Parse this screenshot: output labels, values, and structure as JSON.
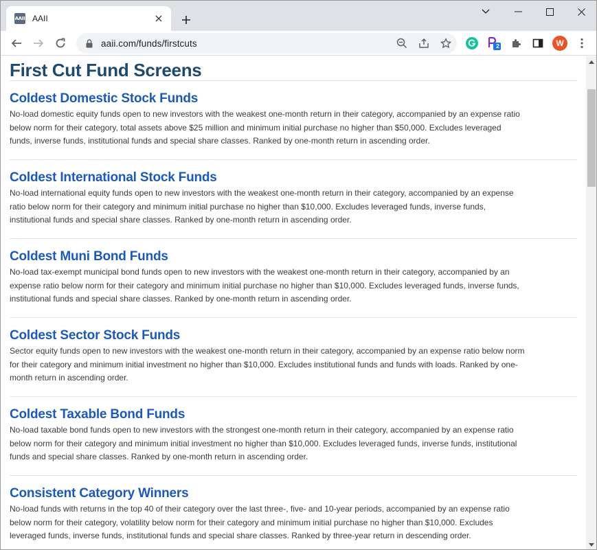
{
  "browser": {
    "tab": {
      "favicon_text": "AAII",
      "title": "AAII"
    },
    "address": {
      "url": "aaii.com/funds/firstcuts"
    },
    "profile_initial": "W",
    "extension_badge": "2",
    "colors": {
      "accent_profile": "#e8542a",
      "grammarly": "#15c39a",
      "ext_p": "#7b2fbf"
    }
  },
  "page": {
    "title": "First Cut Fund Screens",
    "colors": {
      "title": "#1f4a6e",
      "link": "#1d59b8"
    },
    "funds": [
      {
        "title": "Coldest Domestic Stock Funds",
        "description": "No-load domestic equity funds open to new investors with the weakest one-month return in their category, accompanied by an expense ratio below norm for their category, total assets above $25 million and minimum initial purchase no higher than $50,000. Excludes leveraged funds, inverse funds, institutional funds and special share classes. Ranked by one-month return in ascending order."
      },
      {
        "title": "Coldest International Stock Funds",
        "description": "No-load international equity funds open to new investors with the weakest one-month return in their category, accompanied by an expense ratio below norm for their category and minimum initial purchase no higher than $10,000. Excludes leveraged funds, inverse funds, institutional funds and special share classes. Ranked by one-month return in ascending order."
      },
      {
        "title": "Coldest Muni Bond Funds",
        "description": "No-load tax-exempt municipal bond funds open to new investors with the weakest one-month return in their category, accompanied by an expense ratio below norm for their category and minimum initial purchase no higher than $10,000. Excludes leveraged funds, inverse funds, institutional funds and special share classes. Ranked by one-month return in ascending order."
      },
      {
        "title": "Coldest Sector Stock Funds",
        "description": "Sector equity funds open to new investors with the weakest one-month return in their category, accompanied by an expense ratio below norm for their category and minimum initial investment no higher than $10,000. Excludes institutional funds and funds with loads. Ranked by one-month return in ascending order."
      },
      {
        "title": "Coldest Taxable Bond Funds",
        "description": "No-load taxable bond funds open to new investors with the strongest one-month return in their category, accompanied by an expense ratio below norm for their category and minimum initial investment no higher than $10,000. Excludes leveraged funds, inverse funds, institutional funds and special share classes. Ranked by one-month return in ascending order."
      },
      {
        "title": "Consistent Category Winners",
        "description": "No-load funds with returns in the top 40 of their category over the last three-, five- and 10-year periods, accompanied by an expense ratio below norm for their category, volatility below norm for their category and minimum initial purchase no higher than $10,000. Excludes leveraged funds, inverse funds, institutional funds and special share classes. Ranked by three-year return in descending order."
      }
    ]
  }
}
